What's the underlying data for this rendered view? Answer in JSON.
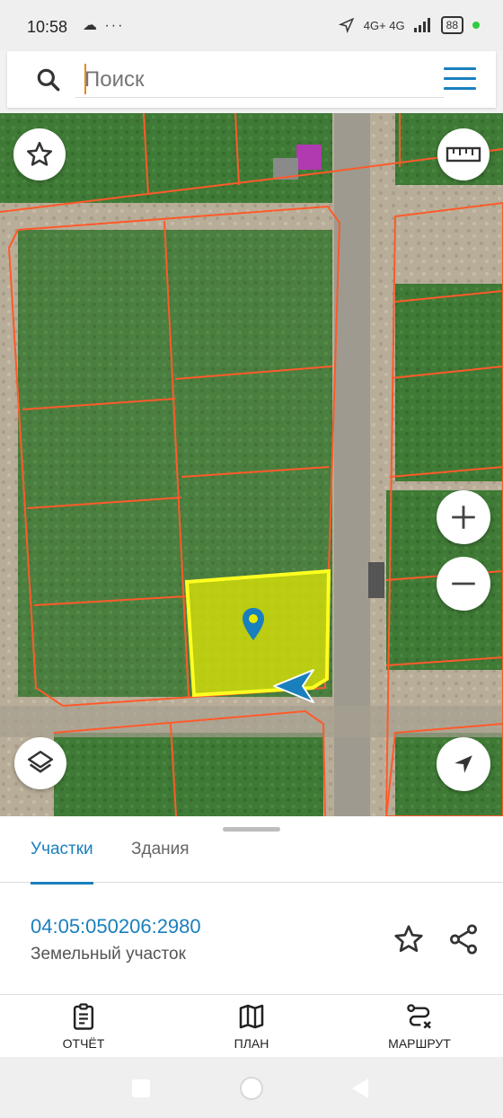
{
  "status_bar": {
    "time": "10:58",
    "left_icons": "☁ ···",
    "network": "4G+ 4G",
    "battery": "88"
  },
  "search": {
    "placeholder": "Поиск",
    "icon": "search-icon",
    "menu_icon": "hamburger-menu-icon"
  },
  "map": {
    "buttons": [
      "favorites-star-button",
      "ruler-button",
      "zoom-in-button",
      "zoom-out-button",
      "layers-button",
      "my-location-button"
    ],
    "selected_parcel_color": "#e6ea00",
    "boundary_color": "#ff5a2a",
    "accent": "#1a7fbd"
  },
  "sheet": {
    "tabs": [
      "Участки",
      "Здания"
    ],
    "active_tab": "Участки",
    "parcel": {
      "cadastral_number": "04:05:050206:2980",
      "type": "Земельный участок"
    }
  },
  "actions": [
    {
      "label": "ОТЧЁТ",
      "icon": "report-clipboard-icon"
    },
    {
      "label": "ПЛАН",
      "icon": "map-plan-icon"
    },
    {
      "label": "МАРШРУТ",
      "icon": "route-icon"
    }
  ]
}
